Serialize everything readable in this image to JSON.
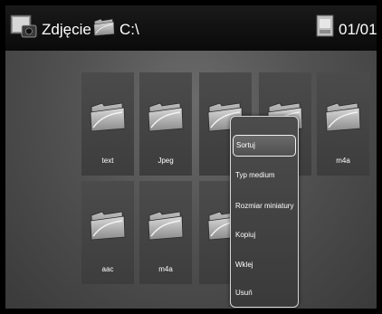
{
  "header": {
    "title": "Zdjęcie",
    "path": "C:\\",
    "page_counter": "01/01",
    "icons": [
      "photo-camera-icon",
      "folder-icon",
      "page-icon"
    ]
  },
  "grid": {
    "items": [
      {
        "label": "text",
        "icon": "folder-icon"
      },
      {
        "label": "Jpeg",
        "icon": "folder-icon"
      },
      {
        "label": "",
        "icon": "folder-icon"
      },
      {
        "label": "",
        "icon": "folder-icon"
      },
      {
        "label": "m4a",
        "icon": "folder-icon"
      },
      {
        "label": "aac",
        "icon": "folder-icon"
      },
      {
        "label": "m4a",
        "icon": "folder-icon"
      },
      {
        "label": "",
        "icon": "folder-icon"
      }
    ]
  },
  "context_menu": {
    "selected_index": 0,
    "items": [
      {
        "label": "Sortuj"
      },
      {
        "label": "Typ medium"
      },
      {
        "label": "Rozmiar miniatury"
      },
      {
        "label": "Kopiuj"
      },
      {
        "label": "Wklej"
      },
      {
        "label": "Usuń"
      }
    ]
  }
}
